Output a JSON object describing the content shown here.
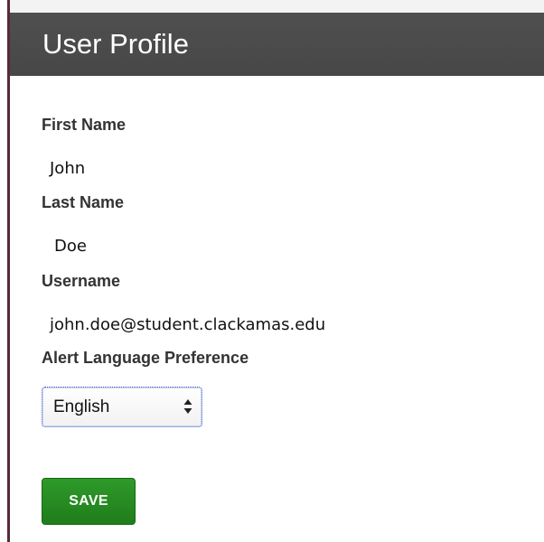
{
  "header": {
    "title": "User Profile"
  },
  "fields": {
    "first_name": {
      "label": "First Name",
      "value": "John"
    },
    "last_name": {
      "label": "Last Name",
      "value": "Doe"
    },
    "username": {
      "label": "Username",
      "value": "john.doe@student.clackamas.edu"
    },
    "alert_language": {
      "label": "Alert Language Preference",
      "selected": "English"
    }
  },
  "actions": {
    "save_label": "SAVE"
  },
  "colors": {
    "header_bg": "#4a4a4a",
    "save_bg": "#2a8a25",
    "accent_rule": "#5a2a36"
  },
  "icons": {
    "select_arrows": "up-down-arrows-icon"
  }
}
